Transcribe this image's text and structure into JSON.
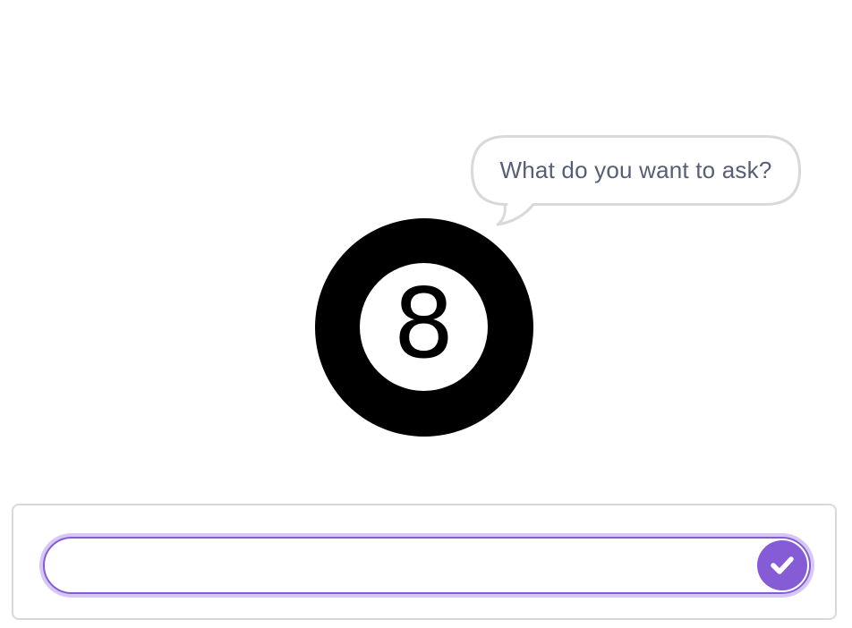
{
  "speech_bubble": {
    "text": "What do you want to ask?"
  },
  "sprite": {
    "name": "8-ball",
    "number": "8"
  },
  "ask_prompt": {
    "input_value": "",
    "input_placeholder": "",
    "submit_icon": "checkmark-icon"
  },
  "colors": {
    "accent": "#855cd6",
    "accent_light": "#d6c7f4",
    "text": "#575e75",
    "border": "#d9d9d9"
  }
}
